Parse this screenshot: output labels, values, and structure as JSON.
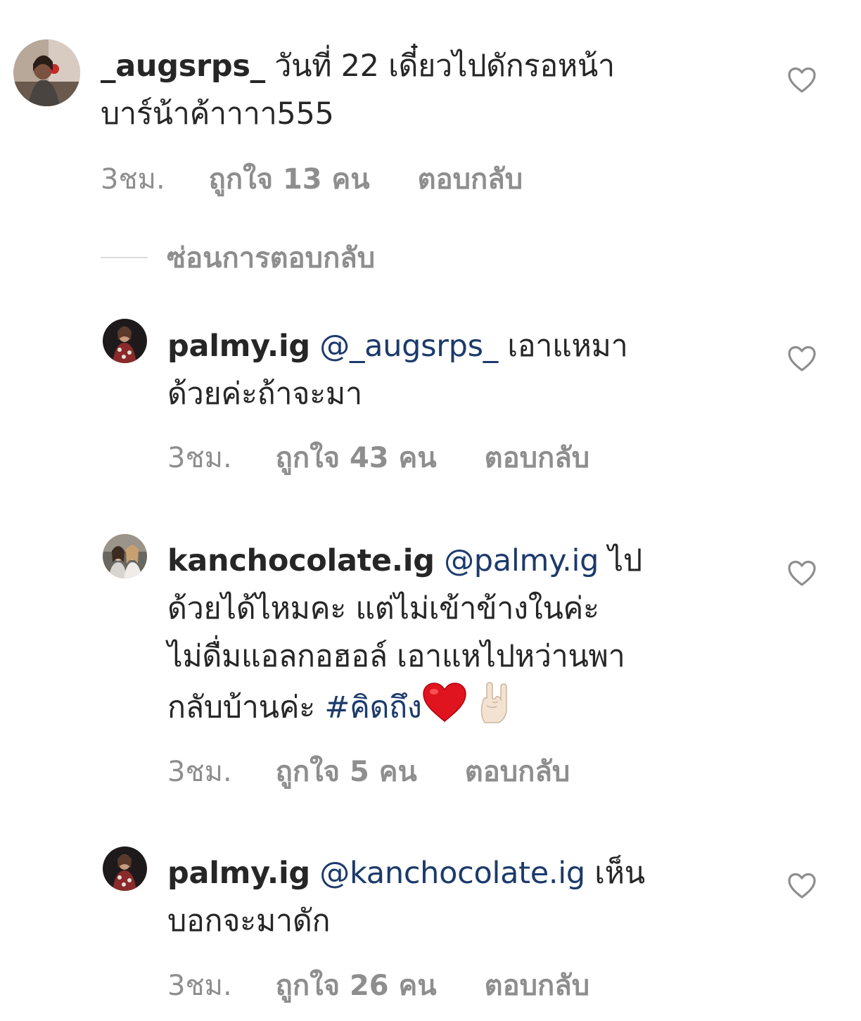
{
  "comments": [
    {
      "username": "_augsrps_",
      "mention": "",
      "text_line1": "วันที่ 22 เดี๋ยวไปดักรอหน้า",
      "text_line2": "บาร์น้าค้าาาา555",
      "time": "3ชม.",
      "likes": "ถูกใจ 13 คน",
      "reply": "ตอบกลับ",
      "heart_icon": "heart-outline-icon"
    },
    {
      "username": "palmy.ig",
      "mention": "@_augsrps_",
      "text_line1": "เอาแหมา",
      "text_line2": "ด้วยค่ะถ้าจะมา",
      "time": "3ชม.",
      "likes": "ถูกใจ 43 คน",
      "reply": "ตอบกลับ",
      "heart_icon": "heart-outline-icon"
    },
    {
      "username": "kanchocolate.ig",
      "mention": "@palmy.ig",
      "text_line1": "ไป",
      "text_line2": "ด้วยได้ไหมคะ แต่ไม่เข้าข้างในค่ะ",
      "text_line3": "ไม่ดื่มแอลกอฮอล์ เอาแหไปหว่านพา",
      "text_line4": "กลับบ้านค่ะ",
      "hashtag": "#คิดถึง",
      "emoji1": "red-heart-emoji",
      "emoji2": "rock-on-hand-emoji",
      "time": "3ชม.",
      "likes": "ถูกใจ 5 คน",
      "reply": "ตอบกลับ",
      "heart_icon": "heart-outline-icon"
    },
    {
      "username": "palmy.ig",
      "mention": "@kanchocolate.ig",
      "text_line1": "เห็น",
      "text_line2": "บอกจะมาดัก",
      "time": "3ชม.",
      "likes": "ถูกใจ 26 คน",
      "reply": "ตอบกลับ",
      "heart_icon": "heart-outline-icon"
    }
  ],
  "hide_replies": {
    "label": "ซ่อนการตอบกลับ"
  },
  "colors": {
    "text": "#262626",
    "meta": "#8e8e8e",
    "link": "#1c3a6b",
    "divider": "#dbdbdb"
  }
}
